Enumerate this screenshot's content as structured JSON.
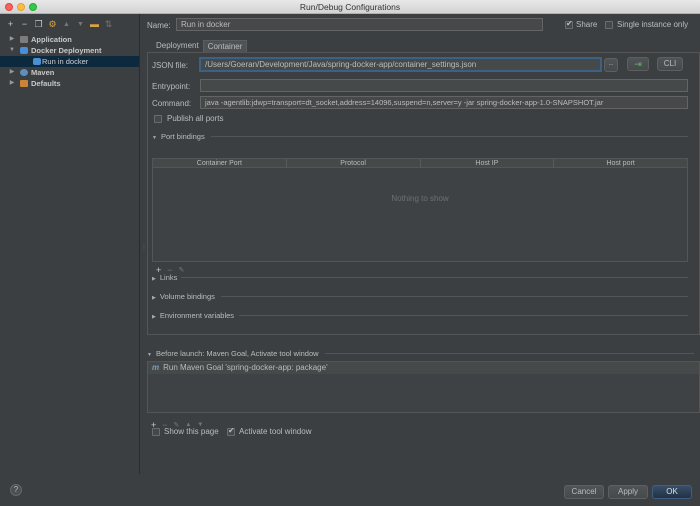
{
  "window": {
    "title": "Run/Debug Configurations"
  },
  "toolbar": {
    "add": "+",
    "remove": "−",
    "copy": "❐",
    "wrench": "⚙",
    "up": "▲",
    "down": "▼",
    "folder": "▬",
    "sort": "⇅"
  },
  "tree": {
    "application": "Application",
    "docker_deployment": "Docker Deployment",
    "run_in_docker": "Run in docker",
    "maven": "Maven",
    "defaults": "Defaults"
  },
  "header": {
    "name_label": "Name:",
    "name_value": "Run in docker",
    "share_label": "Share",
    "share_checked": true,
    "single_instance_label": "Single instance only",
    "single_instance_checked": false
  },
  "tabs": {
    "deployment": "Deployment",
    "container": "Container",
    "active": "Container"
  },
  "container": {
    "json_file_label": "JSON file:",
    "json_file_value": "/Users/Goeran/Development/Java/spring-docker-app/container_settings.json",
    "browse_label": "...",
    "cli_label": "CLI",
    "entrypoint_label": "Entrypoint:",
    "entrypoint_value": "",
    "command_label": "Command:",
    "command_value": "java -agentlib:jdwp=transport=dt_socket,address=14096,suspend=n,server=y -jar spring-docker-app-1.0-SNAPSHOT.jar",
    "publish_all_label": "Publish all ports",
    "publish_all_checked": false,
    "port_bindings_label": "Port bindings",
    "columns": [
      "Container Port",
      "Protocol",
      "Host IP",
      "Host port"
    ],
    "empty_text": "Nothing to show",
    "links_label": "Links",
    "volume_bindings_label": "Volume bindings",
    "env_vars_label": "Environment variables"
  },
  "before_launch": {
    "label": "Before launch: Maven Goal, Activate tool window",
    "items": [
      {
        "icon": "m",
        "text": "Run Maven Goal 'spring-docker-app: package'"
      }
    ]
  },
  "options": {
    "show_page_label": "Show this page",
    "show_page_checked": false,
    "activate_tool_label": "Activate tool window",
    "activate_tool_checked": true
  },
  "buttons": {
    "cancel": "Cancel",
    "apply": "Apply",
    "ok": "OK",
    "help": "?"
  },
  "colors": {
    "background": "#3c3f41",
    "selection": "#0d293e",
    "default_button": "#2f4b6c",
    "docker_icon": "#4a8fd6"
  }
}
